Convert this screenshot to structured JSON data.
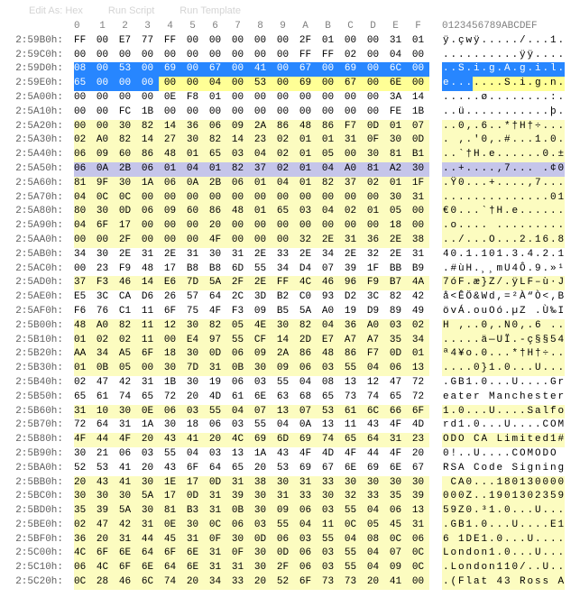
{
  "toolbar": {
    "btn1": "Edit As: Hex",
    "btn2": "Run Script",
    "btn3": "Run Template"
  },
  "header": {
    "addr": "",
    "cols": [
      "0",
      "1",
      "2",
      "3",
      "4",
      "5",
      "6",
      "7",
      "8",
      "9",
      "A",
      "B",
      "C",
      "D",
      "E",
      "F"
    ],
    "txt": "0123456789ABCDEF"
  },
  "rows": [
    {
      "addr": "2:59B0h:",
      "hex": [
        "FF",
        "00",
        "E7",
        "77",
        "FF",
        "00",
        "00",
        "00",
        "00",
        "00",
        "2F",
        "01",
        "00",
        "00",
        "31",
        "01"
      ],
      "txt": "ÿ.çwÿ...../...1."
    },
    {
      "addr": "2:59C0h:",
      "hex": [
        "00",
        "00",
        "00",
        "00",
        "00",
        "00",
        "00",
        "00",
        "00",
        "00",
        "FF",
        "FF",
        "02",
        "00",
        "04",
        "00"
      ],
      "txt": "..........ÿÿ...."
    },
    {
      "addr": "2:59D0h:",
      "hex": [
        "08",
        "00",
        "53",
        "00",
        "69",
        "00",
        "67",
        "00",
        "41",
        "00",
        "67",
        "00",
        "69",
        "00",
        "6C",
        "00"
      ],
      "hl": "sel",
      "txt": "..S.i.g.A.g.i.l.",
      "thl": "sel"
    },
    {
      "addr": "2:59E0h:",
      "hex": [
        "65",
        "00",
        "00",
        "00",
        "00",
        "00",
        "04",
        "00",
        "53",
        "00",
        "69",
        "00",
        "67",
        "00",
        "6E",
        "00"
      ],
      "hlmix": [
        0,
        1,
        2,
        3
      ],
      "y": [
        4,
        5,
        6,
        7,
        8,
        9,
        10,
        11,
        12,
        13,
        14,
        15
      ],
      "txt": "e.......S.i.g.n.",
      "tmix": {
        "sel": [
          0,
          1,
          2,
          3
        ],
        "y": [
          4,
          5,
          6,
          7,
          8,
          9,
          10,
          11,
          12,
          13,
          14,
          15
        ]
      }
    },
    {
      "addr": "2:5A00h:",
      "hex": [
        "00",
        "00",
        "00",
        "00",
        "0E",
        "F8",
        "01",
        "00",
        "00",
        "00",
        "00",
        "00",
        "00",
        "00",
        "3A",
        "14"
      ],
      "txt": ".....ø........:."
    },
    {
      "addr": "2:5A10h:",
      "hex": [
        "00",
        "00",
        "FC",
        "1B",
        "00",
        "00",
        "00",
        "00",
        "00",
        "00",
        "00",
        "00",
        "00",
        "00",
        "FE",
        "1B"
      ],
      "txt": "..ü...........þ."
    },
    {
      "addr": "2:5A20h:",
      "hex": [
        "00",
        "00",
        "30",
        "82",
        "14",
        "36",
        "06",
        "09",
        "2A",
        "86",
        "48",
        "86",
        "F7",
        "0D",
        "01",
        "07"
      ],
      "txt": "..0‚.6..*†H†÷..."
    },
    {
      "addr": "2:5A30h:",
      "hex": [
        "02",
        "A0",
        "82",
        "14",
        "27",
        "30",
        "82",
        "14",
        "23",
        "02",
        "01",
        "01",
        "31",
        "0F",
        "30",
        "0D"
      ],
      "txt": ". ‚.'0‚.#...1.0."
    },
    {
      "addr": "2:5A40h:",
      "hex": [
        "06",
        "09",
        "60",
        "86",
        "48",
        "01",
        "65",
        "03",
        "04",
        "02",
        "01",
        "05",
        "00",
        "30",
        "81",
        "B1"
      ],
      "txt": "..`†H.e......0.±"
    },
    {
      "addr": "2:5A50h:",
      "hex": [
        "06",
        "0A",
        "2B",
        "06",
        "01",
        "04",
        "01",
        "82",
        "37",
        "02",
        "01",
        "04",
        "A0",
        "81",
        "A2",
        "30"
      ],
      "hl": "lav",
      "txt": "..+....‚7... .¢0",
      "thl": "lav"
    },
    {
      "addr": "2:5A60h:",
      "hex": [
        "81",
        "9F",
        "30",
        "1A",
        "06",
        "0A",
        "2B",
        "06",
        "01",
        "04",
        "01",
        "82",
        "37",
        "02",
        "01",
        "1F"
      ],
      "txt": ".Ÿ0...+....‚7..."
    },
    {
      "addr": "2:5A70h:",
      "hex": [
        "04",
        "0C",
        "0C",
        "00",
        "00",
        "00",
        "00",
        "00",
        "00",
        "00",
        "00",
        "00",
        "00",
        "00",
        "30",
        "31"
      ],
      "txt": "..............01"
    },
    {
      "addr": "2:5A80h:",
      "hex": [
        "80",
        "30",
        "0D",
        "06",
        "09",
        "60",
        "86",
        "48",
        "01",
        "65",
        "03",
        "04",
        "02",
        "01",
        "05",
        "00"
      ],
      "txt": "€0...`†H.e......"
    },
    {
      "addr": "2:5A90h:",
      "hex": [
        "04",
        "6F",
        "17",
        "00",
        "00",
        "00",
        "20",
        "00",
        "00",
        "00",
        "00",
        "00",
        "00",
        "00",
        "18",
        "00"
      ],
      "txt": ".o.... ........."
    },
    {
      "addr": "2:5AA0h:",
      "hex": [
        "00",
        "00",
        "2F",
        "00",
        "00",
        "00",
        "4F",
        "00",
        "00",
        "00",
        "32",
        "2E",
        "31",
        "36",
        "2E",
        "38"
      ],
      "txt": "../...O...2.16.8"
    },
    {
      "addr": "2:5AB0h:",
      "hex": [
        "34",
        "30",
        "2E",
        "31",
        "2E",
        "31",
        "30",
        "31",
        "2E",
        "33",
        "2E",
        "34",
        "2E",
        "32",
        "2E",
        "31"
      ],
      "txt": "40.1.101.3.4.2.1"
    },
    {
      "addr": "2:5AC0h:",
      "hex": [
        "00",
        "23",
        "F9",
        "48",
        "17",
        "B8",
        "B8",
        "6D",
        "55",
        "34",
        "D4",
        "07",
        "39",
        "1F",
        "BB",
        "B9"
      ],
      "txt": ".#ùH.¸¸mU4Ô.9.»¹"
    },
    {
      "addr": "2:5AD0h:",
      "hex": [
        "37",
        "F3",
        "46",
        "14",
        "E6",
        "7D",
        "5A",
        "2F",
        "2E",
        "FF",
        "4C",
        "46",
        "96",
        "F9",
        "B7",
        "4A"
      ],
      "txt": "7óF.æ}Z/.ÿLF–ù·J"
    },
    {
      "addr": "2:5AE0h:",
      "hex": [
        "E5",
        "3C",
        "CA",
        "D6",
        "26",
        "57",
        "64",
        "2C",
        "3D",
        "B2",
        "C0",
        "93",
        "D2",
        "3C",
        "82",
        "42"
      ],
      "txt": "å<ÊÖ&Wd,=²À“Ò<‚B"
    },
    {
      "addr": "2:5AF0h:",
      "hex": [
        "F6",
        "76",
        "C1",
        "11",
        "6F",
        "75",
        "4F",
        "F3",
        "09",
        "B5",
        "5A",
        "A0",
        "19",
        "D9",
        "89",
        "49"
      ],
      "txt": "övÁ.ouOó.µZ .Ù‰I"
    },
    {
      "addr": "2:5B00h:",
      "hex": [
        "48",
        "A0",
        "82",
        "11",
        "12",
        "30",
        "82",
        "05",
        "4E",
        "30",
        "82",
        "04",
        "36",
        "A0",
        "03",
        "02"
      ],
      "txt": "H ‚..0‚.N0‚.6 .."
    },
    {
      "addr": "2:5B10h:",
      "hex": [
        "01",
        "02",
        "02",
        "11",
        "00",
        "E4",
        "97",
        "55",
        "CF",
        "14",
        "2D",
        "E7",
        "A7",
        "A7",
        "35",
        "34"
      ],
      "txt": ".....ä—UÏ.-ç§§54"
    },
    {
      "addr": "2:5B20h:",
      "hex": [
        "AA",
        "34",
        "A5",
        "6F",
        "18",
        "30",
        "0D",
        "06",
        "09",
        "2A",
        "86",
        "48",
        "86",
        "F7",
        "0D",
        "01"
      ],
      "txt": "ª4¥o.0...*†H†÷.."
    },
    {
      "addr": "2:5B30h:",
      "hex": [
        "01",
        "0B",
        "05",
        "00",
        "30",
        "7D",
        "31",
        "0B",
        "30",
        "09",
        "06",
        "03",
        "55",
        "04",
        "06",
        "13"
      ],
      "txt": "....0}1.0...U..."
    },
    {
      "addr": "2:5B40h:",
      "hex": [
        "02",
        "47",
        "42",
        "31",
        "1B",
        "30",
        "19",
        "06",
        "03",
        "55",
        "04",
        "08",
        "13",
        "12",
        "47",
        "72"
      ],
      "txt": ".GB1.0...U....Gr"
    },
    {
      "addr": "2:5B50h:",
      "hex": [
        "65",
        "61",
        "74",
        "65",
        "72",
        "20",
        "4D",
        "61",
        "6E",
        "63",
        "68",
        "65",
        "73",
        "74",
        "65",
        "72"
      ],
      "txt": "eater Manchester"
    },
    {
      "addr": "2:5B60h:",
      "hex": [
        "31",
        "10",
        "30",
        "0E",
        "06",
        "03",
        "55",
        "04",
        "07",
        "13",
        "07",
        "53",
        "61",
        "6C",
        "66",
        "6F"
      ],
      "txt": "1.0...U....Salfo"
    },
    {
      "addr": "2:5B70h:",
      "hex": [
        "72",
        "64",
        "31",
        "1A",
        "30",
        "18",
        "06",
        "03",
        "55",
        "04",
        "0A",
        "13",
        "11",
        "43",
        "4F",
        "4D"
      ],
      "txt": "rd1.0...U....COM"
    },
    {
      "addr": "2:5B80h:",
      "hex": [
        "4F",
        "44",
        "4F",
        "20",
        "43",
        "41",
        "20",
        "4C",
        "69",
        "6D",
        "69",
        "74",
        "65",
        "64",
        "31",
        "23"
      ],
      "txt": "ODO CA Limited1#"
    },
    {
      "addr": "2:5B90h:",
      "hex": [
        "30",
        "21",
        "06",
        "03",
        "55",
        "04",
        "03",
        "13",
        "1A",
        "43",
        "4F",
        "4D",
        "4F",
        "44",
        "4F",
        "20"
      ],
      "txt": "0!..U....COMODO "
    },
    {
      "addr": "2:5BA0h:",
      "hex": [
        "52",
        "53",
        "41",
        "20",
        "43",
        "6F",
        "64",
        "65",
        "20",
        "53",
        "69",
        "67",
        "6E",
        "69",
        "6E",
        "67"
      ],
      "txt": "RSA Code Signing"
    },
    {
      "addr": "2:5BB0h:",
      "hex": [
        "20",
        "43",
        "41",
        "30",
        "1E",
        "17",
        "0D",
        "31",
        "38",
        "30",
        "31",
        "33",
        "30",
        "30",
        "30",
        "30"
      ],
      "txt": " CA0...180130000"
    },
    {
      "addr": "2:5BC0h:",
      "hex": [
        "30",
        "30",
        "30",
        "5A",
        "17",
        "0D",
        "31",
        "39",
        "30",
        "31",
        "33",
        "30",
        "32",
        "33",
        "35",
        "39"
      ],
      "txt": "000Z..1901302359"
    },
    {
      "addr": "2:5BD0h:",
      "hex": [
        "35",
        "39",
        "5A",
        "30",
        "81",
        "B3",
        "31",
        "0B",
        "30",
        "09",
        "06",
        "03",
        "55",
        "04",
        "06",
        "13"
      ],
      "txt": "59Z0.³1.0...U..."
    },
    {
      "addr": "2:5BE0h:",
      "hex": [
        "02",
        "47",
        "42",
        "31",
        "0E",
        "30",
        "0C",
        "06",
        "03",
        "55",
        "04",
        "11",
        "0C",
        "05",
        "45",
        "31"
      ],
      "txt": ".GB1.0...U....E1"
    },
    {
      "addr": "2:5BF0h:",
      "hex": [
        "36",
        "20",
        "31",
        "44",
        "45",
        "31",
        "0F",
        "30",
        "0D",
        "06",
        "03",
        "55",
        "04",
        "08",
        "0C",
        "06"
      ],
      "txt": "6 1DE1.0...U...."
    },
    {
      "addr": "2:5C00h:",
      "hex": [
        "4C",
        "6F",
        "6E",
        "64",
        "6F",
        "6E",
        "31",
        "0F",
        "30",
        "0D",
        "06",
        "03",
        "55",
        "04",
        "07",
        "0C"
      ],
      "txt": "London1.0...U..."
    },
    {
      "addr": "2:5C10h:",
      "hex": [
        "06",
        "4C",
        "6F",
        "6E",
        "64",
        "6E",
        "31",
        "31",
        "30",
        "2F",
        "06",
        "03",
        "55",
        "04",
        "09",
        "0C"
      ],
      "txt": ".London110/..U.."
    },
    {
      "addr": "2:5C20h:",
      "hex": [
        "0C",
        "28",
        "46",
        "6C",
        "74",
        "20",
        "34",
        "33",
        "20",
        "52",
        "6F",
        "73",
        "73",
        "20",
        "41",
        "00"
      ],
      "txt": ".(Flat 43 Ross A"
    }
  ],
  "byRows": [
    "2:5A20h:",
    "2:5A30h:",
    "2:5A40h:",
    "2:5A50h:",
    "2:5A60h:",
    "2:5A70h:",
    "2:5A80h:",
    "2:5A90h:",
    "2:5AA0h:",
    "2:5AD0h:",
    "2:5B00h:",
    "2:5B10h:",
    "2:5B20h:",
    "2:5B30h:",
    "2:5B60h:",
    "2:5B80h:",
    "2:5BB0h:",
    "2:5BC0h:",
    "2:5BD0h:",
    "2:5BE0h:",
    "2:5BF0h:",
    "2:5C00h:",
    "2:5C10h:",
    "2:5C20h:"
  ]
}
